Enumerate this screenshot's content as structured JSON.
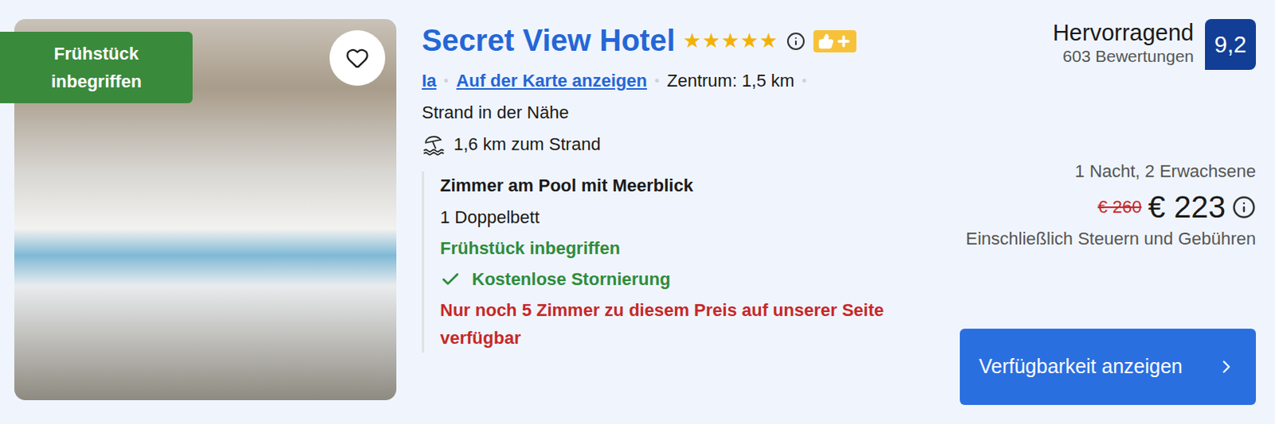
{
  "badge": "Frühstück inbegriffen",
  "favorite": {
    "selected": false
  },
  "hotel": {
    "name": "Secret View Hotel",
    "stars": 5
  },
  "location": {
    "city": "Ia",
    "map_link": "Auf der Karte anzeigen",
    "center": "Zentrum: 1,5 km",
    "beach_note": "Strand in der Nähe",
    "beach_distance": "1,6 km zum Strand"
  },
  "room": {
    "name": "Zimmer am Pool mit Meerblick",
    "bed": "1 Doppelbett",
    "breakfast": "Frühstück inbegriffen",
    "cancellation": "Kostenlose Stornierung",
    "scarcity": "Nur noch 5 Zimmer zu diesem Preis auf unserer Seite verfügbar"
  },
  "rating": {
    "label": "Hervorragend",
    "reviews": "603 Bewertungen",
    "score": "9,2"
  },
  "price": {
    "stay": "1 Nacht, 2 Erwachsene",
    "old": "€ 260",
    "current": "€ 223",
    "note": "Einschließlich Steuern und Gebühren"
  },
  "button": "Verfügbarkeit anzeigen"
}
